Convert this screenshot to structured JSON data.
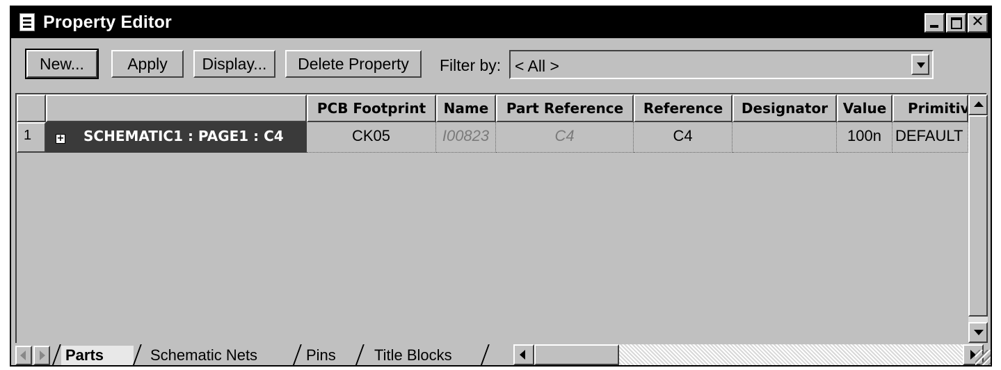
{
  "window": {
    "title": "Property Editor"
  },
  "toolbar": {
    "new_label": "New...",
    "apply_label": "Apply",
    "display_label": "Display...",
    "delete_label": "Delete Property",
    "filter_label": "Filter by:",
    "filter_value": "< All >"
  },
  "grid": {
    "columns": [
      "PCB Footprint",
      "Name",
      "Part Reference",
      "Reference",
      "Designator",
      "Value",
      "Primitiv"
    ],
    "rows": [
      {
        "number": "1",
        "expander": "+",
        "label": "SCHEMATIC1 : PAGE1 : C4",
        "cells": [
          "CK05",
          "I00823",
          "C4",
          "C4",
          "",
          "100n",
          "DEFAULT"
        ]
      }
    ]
  },
  "tabs": [
    "Parts",
    "Schematic Nets",
    "Pins",
    "Title Blocks"
  ],
  "active_tab": "Parts"
}
